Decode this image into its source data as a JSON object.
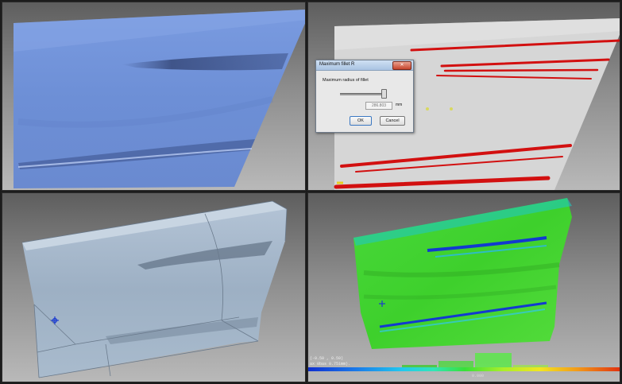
{
  "viewports": [
    {
      "id": "top-left",
      "content": "blue-surface-panel"
    },
    {
      "id": "top-right",
      "content": "fillet-analysis"
    },
    {
      "id": "bottom-left",
      "content": "wireframe-surface-panel"
    },
    {
      "id": "bottom-right",
      "content": "deviation-colormap"
    }
  ],
  "dialog": {
    "title": "Maximum fillet R",
    "close_label": "✕",
    "label": "Maximum radius of fillet",
    "value": "286.803",
    "unit": "mm",
    "ok_label": "OK",
    "cancel_label": "Cancel",
    "slider_fraction": 0.95
  },
  "legend": {
    "range": "(-0.50 , 0.50)",
    "max_line": "ax 0bas 0.751mm).",
    "zero_label": "0.000"
  },
  "colors": {
    "surface_blue": "#6f92d8",
    "surface_gray": "#d6d6d6",
    "fillet_red": "#d21010",
    "deviation_green": "#3ed02c",
    "panel_steel": "#9fb1c4"
  }
}
